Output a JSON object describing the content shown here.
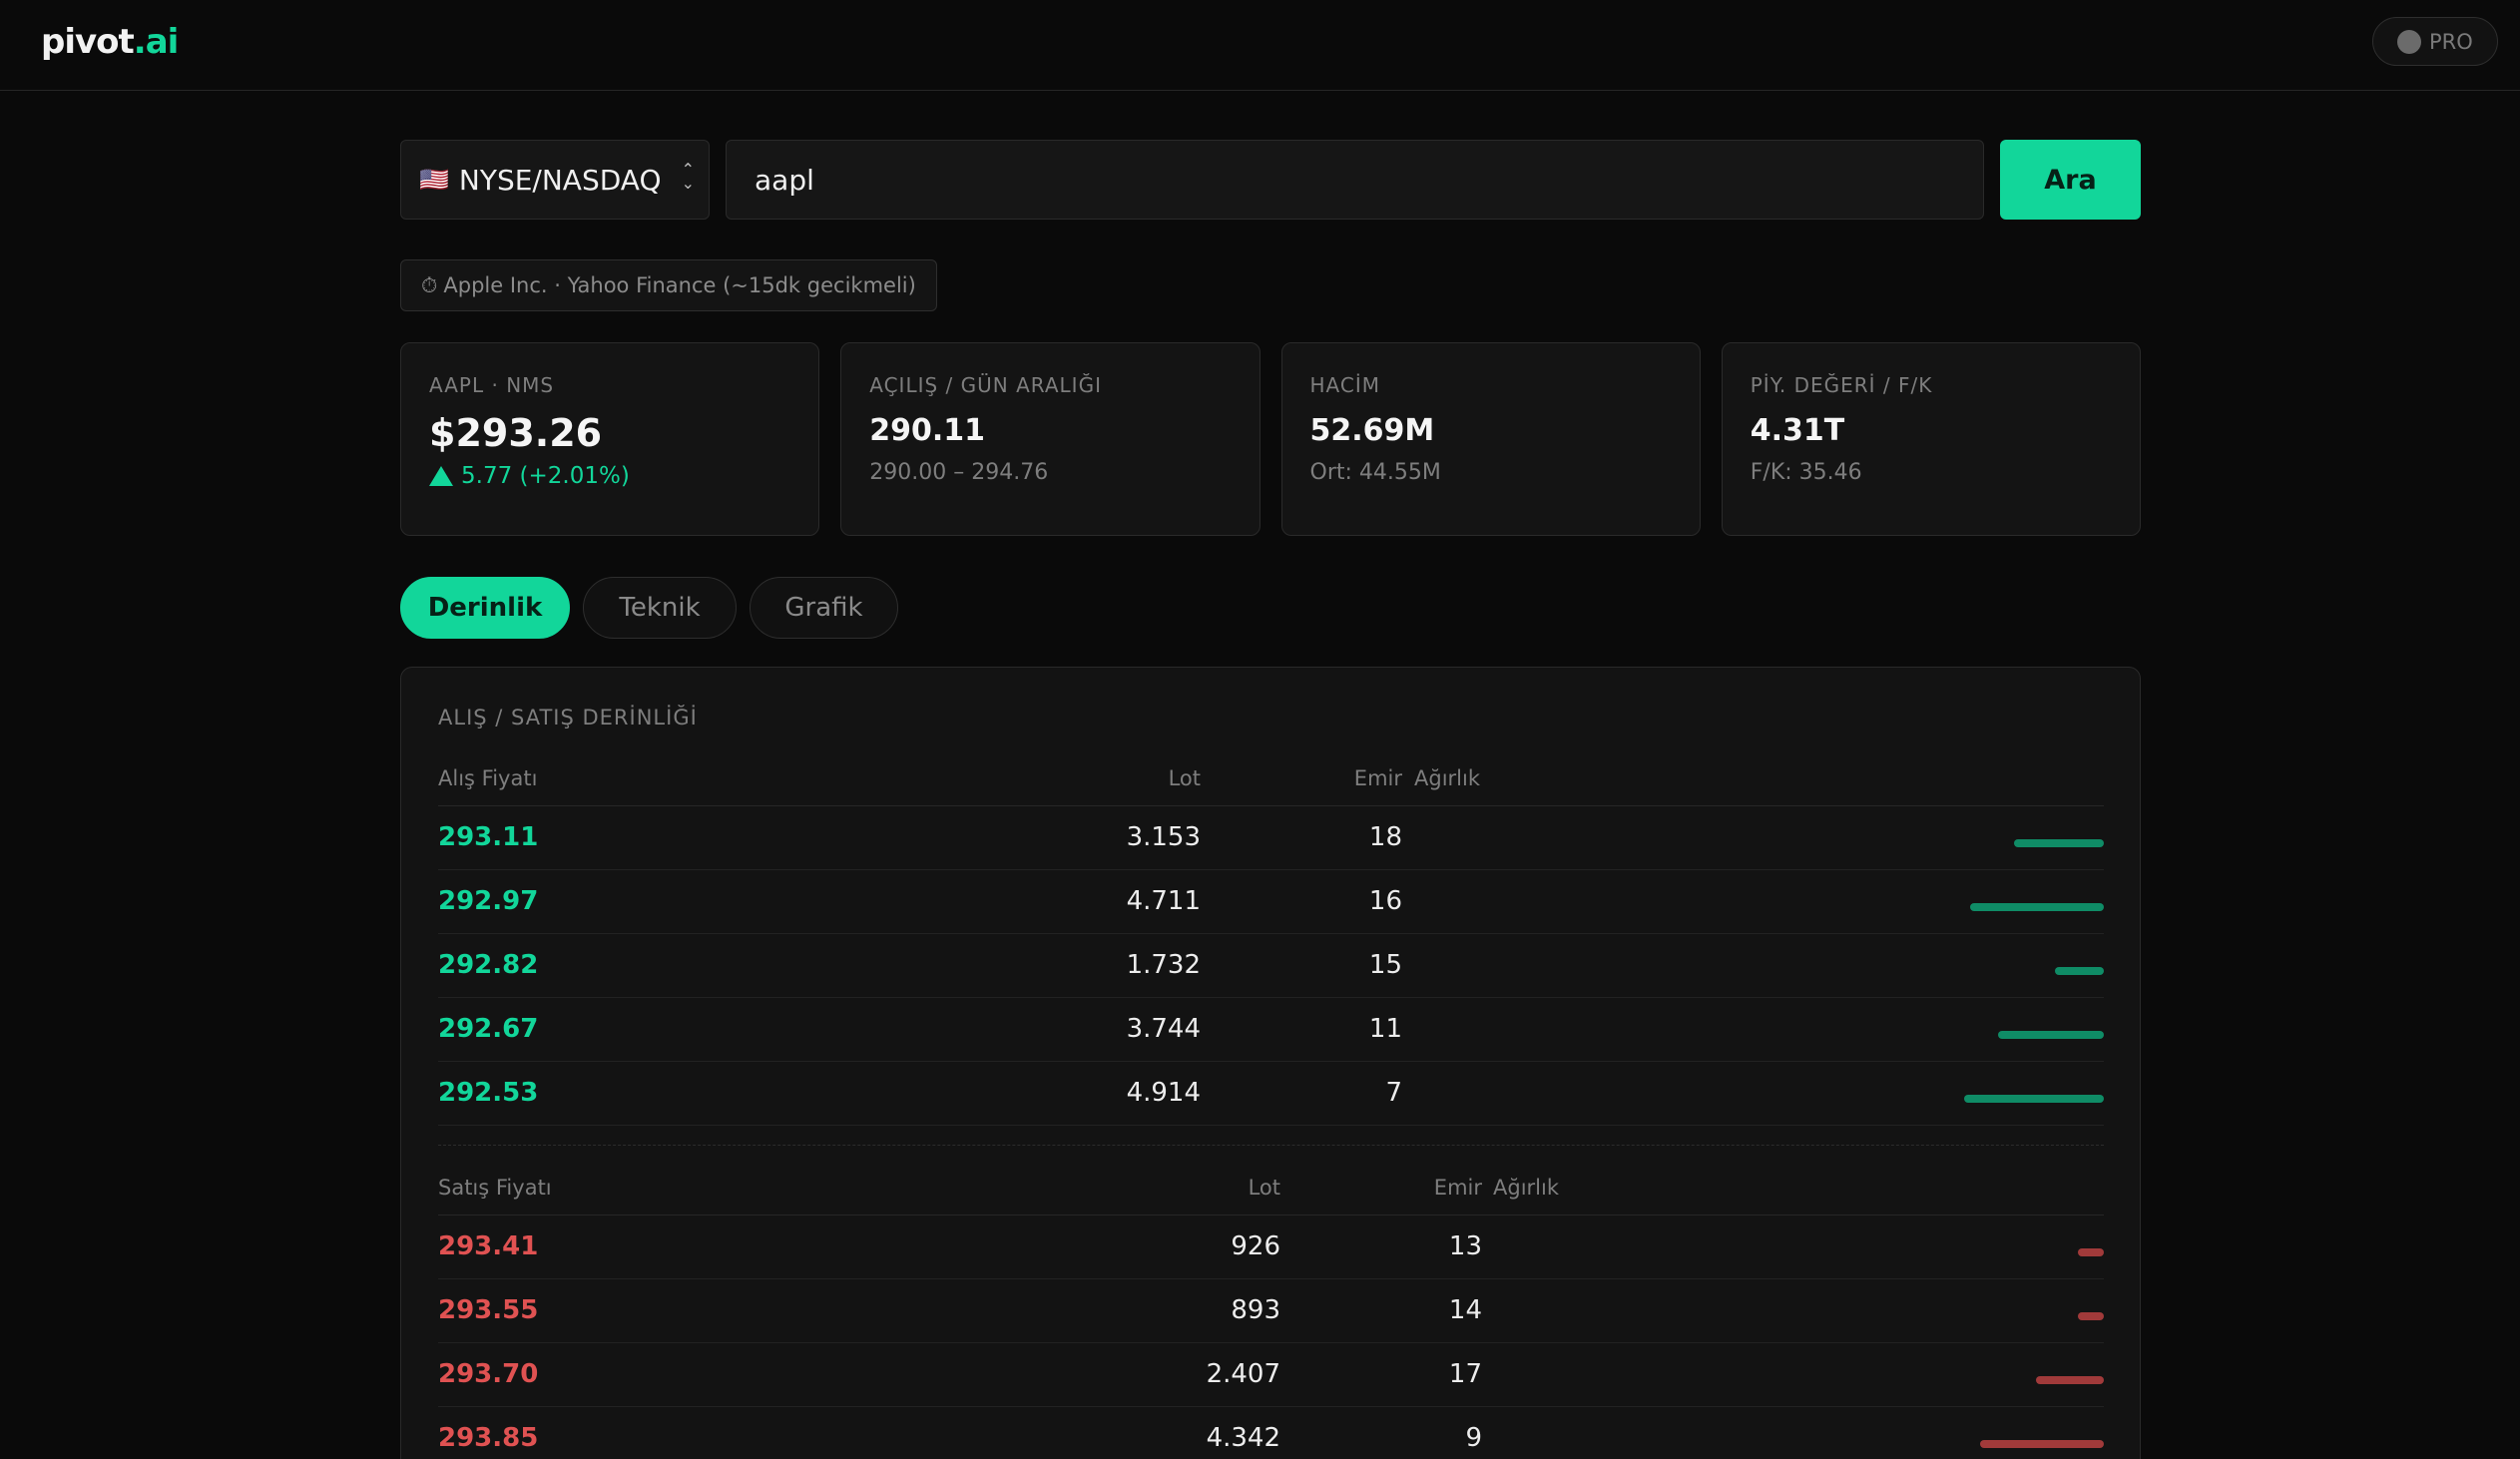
{
  "app": {
    "logo_main": "pivot",
    "logo_accent": ".ai",
    "pro_label": "PRO"
  },
  "search": {
    "exchange": "NYSE/NASDAQ",
    "flag": "🇺🇸",
    "query": "aapl",
    "button": "Ara"
  },
  "source_note": {
    "icon": "clock-icon",
    "text": "Apple Inc. · Yahoo Finance (~15dk gecikmeli)"
  },
  "stats": [
    {
      "label": "AAPL · NMS",
      "value": "$293.26",
      "change": "5.77 (+2.01%)"
    },
    {
      "label": "AÇILIŞ / GÜN ARALIĞI",
      "value": "290.11",
      "sub": "290.00 – 294.76"
    },
    {
      "label": "HACİM",
      "value": "52.69M",
      "sub": "Ort: 44.55M"
    },
    {
      "label": "PİY. DEĞERİ / F/K",
      "value": "4.31T",
      "sub": "F/K: 35.46"
    }
  ],
  "tabs": [
    "Derinlik",
    "Teknik",
    "Grafik"
  ],
  "depth": {
    "title": "ALIŞ / SATIŞ DERİNLİĞİ",
    "bid_headers": {
      "price": "Alış Fiyatı",
      "lot": "Lot",
      "orders": "Emir",
      "weight": "Ağırlık"
    },
    "ask_headers": {
      "price": "Satış Fiyatı",
      "lot": "Lot",
      "orders": "Emir",
      "weight": "Ağırlık"
    },
    "bids": [
      {
        "price": "293.11",
        "lot": "3.153",
        "orders": "18",
        "weight": 0.64
      },
      {
        "price": "292.97",
        "lot": "4.711",
        "orders": "16",
        "weight": 0.96
      },
      {
        "price": "292.82",
        "lot": "1.732",
        "orders": "15",
        "weight": 0.35
      },
      {
        "price": "292.67",
        "lot": "3.744",
        "orders": "11",
        "weight": 0.76
      },
      {
        "price": "292.53",
        "lot": "4.914",
        "orders": "7",
        "weight": 1.0
      }
    ],
    "asks": [
      {
        "price": "293.41",
        "lot": "926",
        "orders": "13",
        "weight": 0.21
      },
      {
        "price": "293.55",
        "lot": "893",
        "orders": "14",
        "weight": 0.21
      },
      {
        "price": "293.70",
        "lot": "2.407",
        "orders": "17",
        "weight": 0.55
      },
      {
        "price": "293.85",
        "lot": "4.342",
        "orders": "9",
        "weight": 1.0
      }
    ]
  },
  "colors": {
    "accent": "#12d69a",
    "bid": "#0f8c66",
    "ask": "#a13a3a",
    "ask_text": "#e05252"
  }
}
